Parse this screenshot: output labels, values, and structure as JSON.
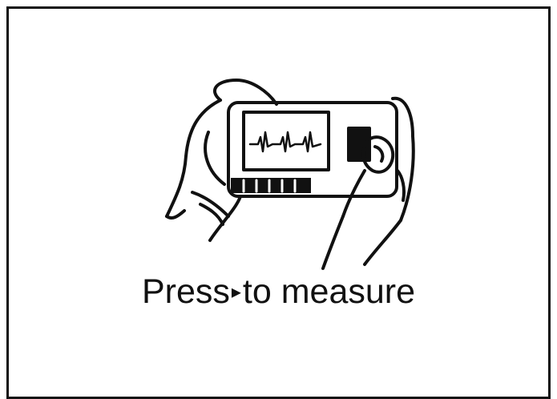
{
  "screen": {
    "prompt_before": "Press",
    "prompt_arrow": "▸",
    "prompt_after": "to measure"
  },
  "illustration": {
    "icon": "handheld-ecg-device-in-hands-icon"
  },
  "colors": {
    "ink": "#111111",
    "background": "#ffffff"
  }
}
